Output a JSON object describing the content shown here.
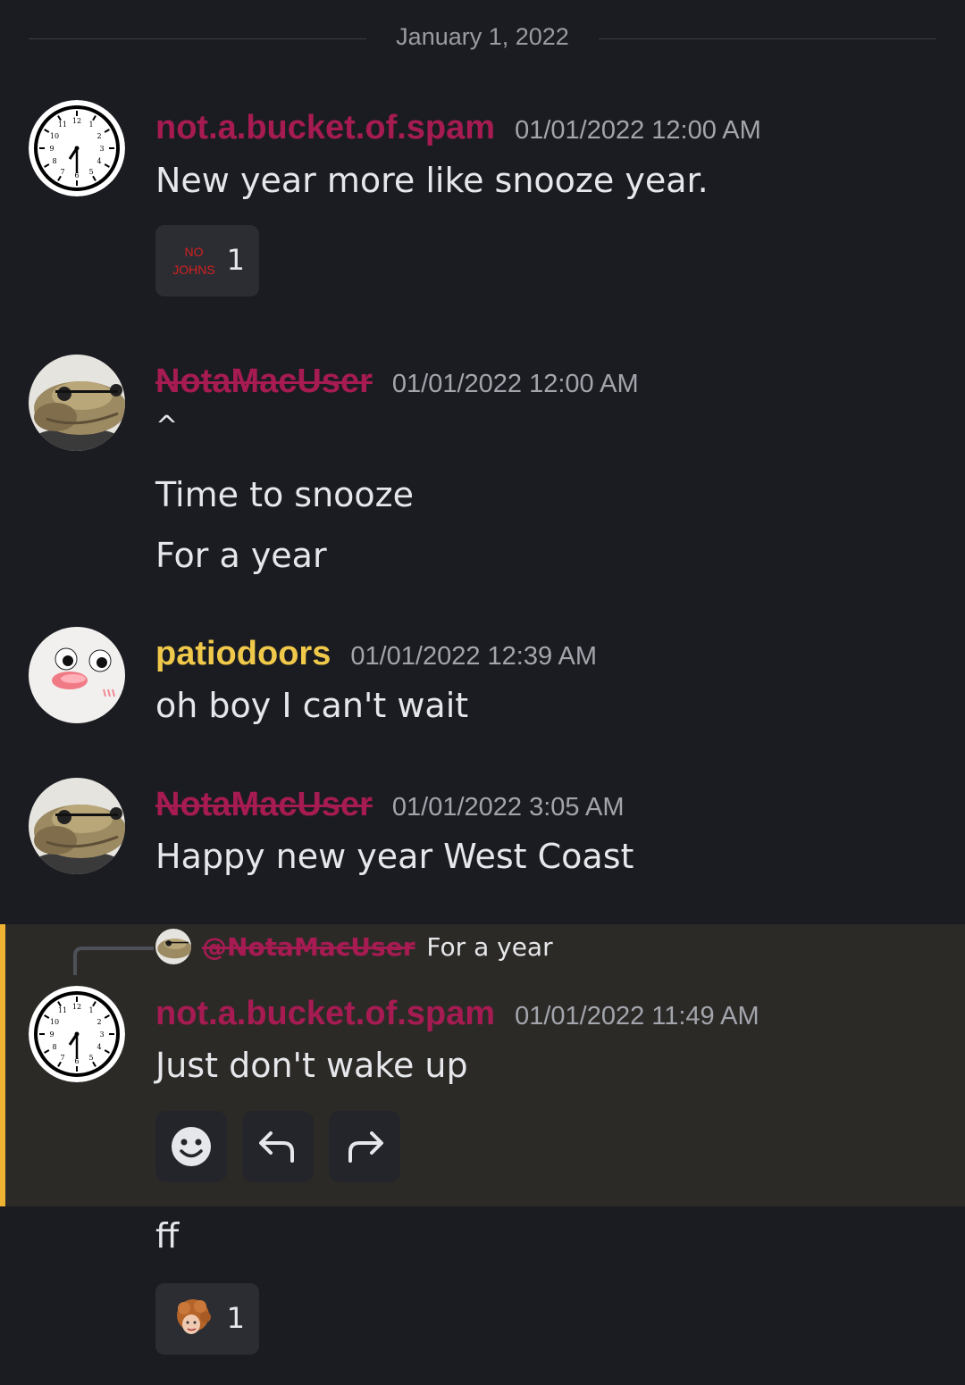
{
  "date_divider": "January 1, 2022",
  "colors": {
    "background": "#1b1c21",
    "user_red": "#a61b52",
    "user_yellow": "#f0c94a",
    "highlight_bar": "#f0b232",
    "highlight_bg": "#2c2a27"
  },
  "messages": [
    {
      "username": "not.a.bucket.of.spam",
      "timestamp": "01/01/2022 12:00 AM",
      "lines": [
        "New year more like snooze year."
      ],
      "avatar": "clock-avatar",
      "reaction": {
        "label": "NO\nJOHNS",
        "line1": "NO",
        "line2": "JOHNS",
        "count": "1"
      }
    },
    {
      "username": "NotaMacUser",
      "timestamp": "01/01/2022 12:00 AM",
      "lines": [
        "^",
        "Time to snooze",
        "For a year"
      ],
      "avatar": "lizard-avatar"
    },
    {
      "username": "patiodoors",
      "timestamp": "01/01/2022 12:39 AM",
      "lines": [
        "oh boy I can't wait"
      ],
      "avatar": "duck-face-avatar"
    },
    {
      "username": "NotaMacUser",
      "timestamp": "01/01/2022 3:05 AM",
      "lines": [
        "Happy new year West Coast"
      ],
      "avatar": "lizard-avatar"
    },
    {
      "reply_to": {
        "mention": "@NotaMacUser",
        "text": "For a year"
      },
      "username": "not.a.bucket.of.spam",
      "timestamp": "01/01/2022 11:49 AM",
      "lines": [
        "Just don't wake up"
      ],
      "avatar": "clock-avatar",
      "actions": [
        "add-reaction-icon",
        "reply-icon",
        "forward-icon"
      ]
    }
  ],
  "trailing_message": {
    "lines": [
      "ff"
    ],
    "reaction": {
      "emoji": "curly-hair-person-emoji",
      "count": "1"
    }
  }
}
